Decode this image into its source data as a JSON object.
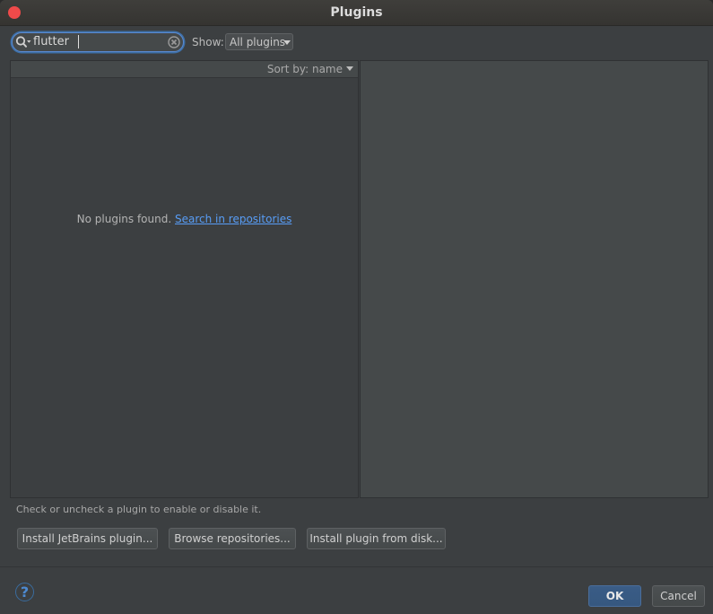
{
  "window": {
    "title": "Plugins"
  },
  "search": {
    "value": "flutter"
  },
  "filter": {
    "label": "Show:",
    "selected": "All plugins"
  },
  "list": {
    "sort_label": "Sort by: name",
    "empty_message": "No plugins found.",
    "empty_link": "Search in repositories"
  },
  "hint": "Check or uncheck a plugin to enable or disable it.",
  "actions": {
    "install_jetbrains": "Install JetBrains plugin...",
    "browse_repositories": "Browse repositories...",
    "install_from_disk": "Install plugin from disk..."
  },
  "footer": {
    "help_glyph": "?",
    "ok": "OK",
    "cancel": "Cancel"
  },
  "colors": {
    "accent": "#589df6",
    "close": "#ef4a4a",
    "ok_button": "#365880"
  },
  "icons": [
    "close-icon",
    "search-icon",
    "clear-icon",
    "chevron-down-icon",
    "help-icon"
  ]
}
